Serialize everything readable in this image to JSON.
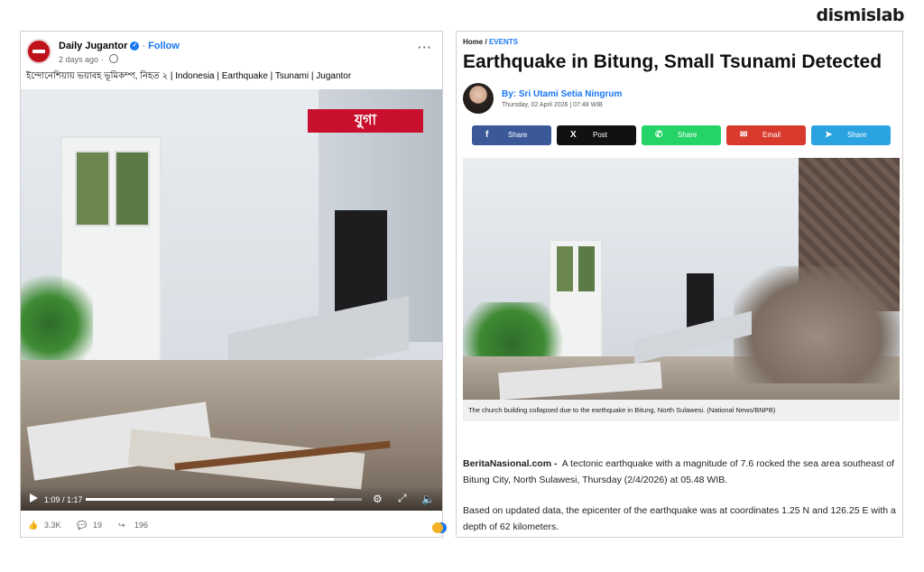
{
  "brand": "dismislab",
  "facebook_post": {
    "page_name": "Daily Jugantor",
    "follow_label": "Follow",
    "time_ago": "2 days ago",
    "caption": "ইন্দোনেশিয়ায় ভয়াবহ ভূমিকম্প, নিহত ২ | Indonesia | Earthquake | Tsunami | Jugantor",
    "video": {
      "watermark": "যুগা",
      "time_display": "1:09 / 1:17",
      "progress": 0.9
    },
    "reactions": {
      "likes": "3.3K",
      "comments": "19",
      "shares": "196"
    }
  },
  "article": {
    "breadcrumb_home": "Home",
    "breadcrumb_sep": "/",
    "breadcrumb_section": "EVENTS",
    "headline": "Earthquake in Bitung, Small Tsunami Detected",
    "author": "By: Sri Utami Setia Ningrum",
    "published": "Thursday, 02 April 2026 | 07:48 WIB",
    "share_buttons": [
      {
        "icon": "f",
        "label": "Share"
      },
      {
        "icon": "X",
        "label": "Post"
      },
      {
        "icon": "✆",
        "label": "Share"
      },
      {
        "icon": "✉",
        "label": "Email"
      },
      {
        "icon": "➤",
        "label": "Share"
      }
    ],
    "photo_caption": "The church building collapsed due to the earthquake in Bitung, North Sulawesi. (National News/BNPB)",
    "source_lead": "BeritaNasional.com -",
    "paragraph1": "A tectonic earthquake with a magnitude of 7.6 rocked the sea area southeast of Bitung City, North Sulawesi, Thursday (2/4/2026) at 05.48 WIB.",
    "paragraph2": "Based on updated data, the epicenter of the earthquake was at coordinates 1.25 N and 126.25 E with a depth of 62 kilometers."
  }
}
